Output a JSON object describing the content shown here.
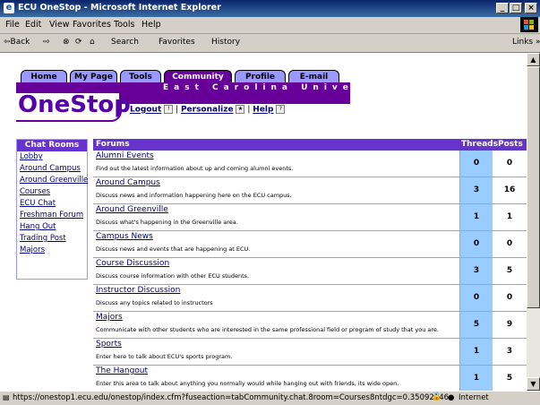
{
  "window": {
    "title": "ECU OneStop - Microsoft Internet Explorer",
    "ie_icon": "ie-icon"
  },
  "menu": [
    "File",
    "Edit",
    "View",
    "Favorites",
    "Tools",
    "Help"
  ],
  "toolbar": {
    "back": "⇦Back",
    "forward": "⇨",
    "stop": "⊗",
    "refresh": "⟳",
    "home": "⌂",
    "search": "Search",
    "favorites": "Favorites",
    "history": "History",
    "links": "Links »"
  },
  "site": {
    "tabs": [
      "Home",
      "My Page",
      "Tools",
      "Community",
      "Profile",
      "E-mail"
    ],
    "active_tab": "Community",
    "logo": "OneStop",
    "university": "East Carolina University",
    "logout": "Logout",
    "personalize": "Personalize",
    "help": "Help",
    "separator": "|"
  },
  "sidebar": {
    "header": "Chat Rooms",
    "rooms": [
      "Lobby",
      "Around Campus",
      "Around Greenville",
      "Courses",
      "ECU Chat",
      "Freshman Forum",
      "Hang Out",
      "Trading Post",
      "Majors"
    ]
  },
  "forums": {
    "headers": {
      "forums": "Forums",
      "threads": "Threads",
      "posts": "Posts"
    },
    "rows": [
      {
        "name": "Alumni Events",
        "desc": "Find out the latest information about up and coming alumni events.",
        "threads": "0",
        "posts": "0"
      },
      {
        "name": "Around Campus",
        "desc": "Discuss news and information happening here on the ECU campus.",
        "threads": "3",
        "posts": "16"
      },
      {
        "name": "Around Greenville",
        "desc": "Discuss what's happening in the Greenville area.",
        "threads": "1",
        "posts": "1"
      },
      {
        "name": "Campus News",
        "desc": "Discuss news and events that are happening at ECU.",
        "threads": "0",
        "posts": "0"
      },
      {
        "name": "Course Discussion",
        "desc": "Discuss course information with other ECU students.",
        "threads": "3",
        "posts": "5"
      },
      {
        "name": "Instructor Discussion",
        "desc": "Discuss any topics related to instructors",
        "threads": "0",
        "posts": "0"
      },
      {
        "name": "Majors",
        "desc": "Communicate with other students who are interested in the same professional field or program of study that you are.",
        "threads": "5",
        "posts": "9"
      },
      {
        "name": "Sports",
        "desc": "Enter here to talk about ECU's sports program.",
        "threads": "1",
        "posts": "3"
      },
      {
        "name": "The Hangout",
        "desc": "Enter this area to talk about anything you normally would while hanging out with friends, its wide open.",
        "threads": "1",
        "posts": "5"
      }
    ]
  },
  "status": {
    "url": "https://onestop1.ecu.edu/onestop/index.cfm?fuseaction=tabCommunity.chat.8room=Courses8ntdgc=0.35092146",
    "zone": "Internet"
  },
  "colors": {
    "purple": "#660099",
    "tab_inactive": "#9999ff",
    "header": "#6633cc",
    "threads_bg": "#99ccff"
  }
}
